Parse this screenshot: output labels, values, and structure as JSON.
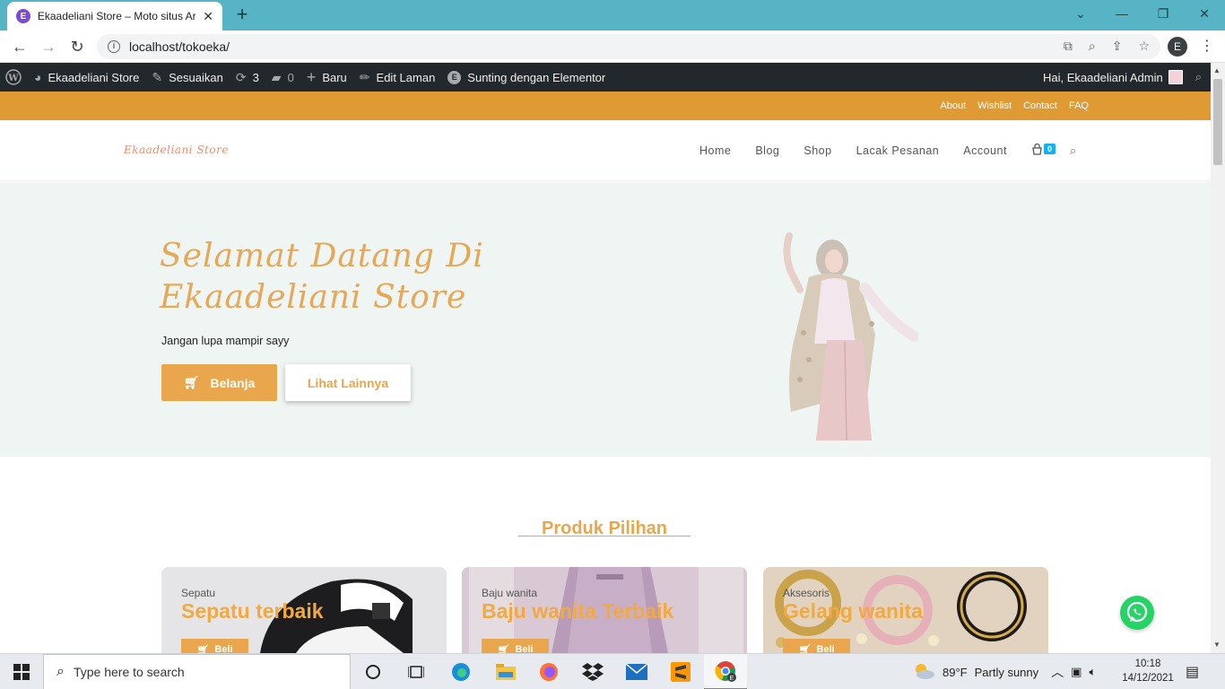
{
  "browser": {
    "tab_title": "Ekaadeliani Store – Moto situs Ar",
    "tab_favicon": "E",
    "url": "localhost/tokoeka/",
    "profile_initial": "E"
  },
  "adminbar": {
    "site_name": "Ekaadeliani Store",
    "customize": "Sesuaikan",
    "updates_count": "3",
    "comments_count": "0",
    "new": "Baru",
    "edit_page": "Edit Laman",
    "elementor": "Sunting dengan Elementor",
    "greeting": "Hai, Ekaadeliani Admin"
  },
  "topbar": {
    "links": [
      "About",
      "Wishlist",
      "Contact",
      "FAQ"
    ]
  },
  "header": {
    "logo": "Ekaadeliani Store",
    "nav": [
      "Home",
      "Blog",
      "Shop",
      "Lacak Pesanan",
      "Account"
    ],
    "cart_count": "0"
  },
  "hero": {
    "title": "Selamat Datang Di Ekaadeliani Store",
    "subtitle": "Jangan lupa mampir sayy",
    "btn_shop": "Belanja",
    "btn_more": "Lihat Lainnya"
  },
  "featured": {
    "title": "Produk Pilihan",
    "cards": [
      {
        "category": "Sepatu",
        "title": "Sepatu terbaik",
        "button": "Beli"
      },
      {
        "category": "Baju wanita",
        "title": "Baju wanita Terbaik",
        "button": "Beli"
      },
      {
        "category": "Aksesoris",
        "title": "Gelang wanita",
        "button": "Beli"
      }
    ]
  },
  "taskbar": {
    "search_placeholder": "Type here to search",
    "weather_temp": "89°F",
    "weather_text": "Partly sunny",
    "time": "10:18",
    "date": "14/12/2021"
  },
  "colors": {
    "accent": "#e09a34",
    "button": "#e9a64c",
    "hero_bg": "#eff5f2",
    "adminbar": "#23282d",
    "browser_tabbar": "#56b4c4"
  }
}
